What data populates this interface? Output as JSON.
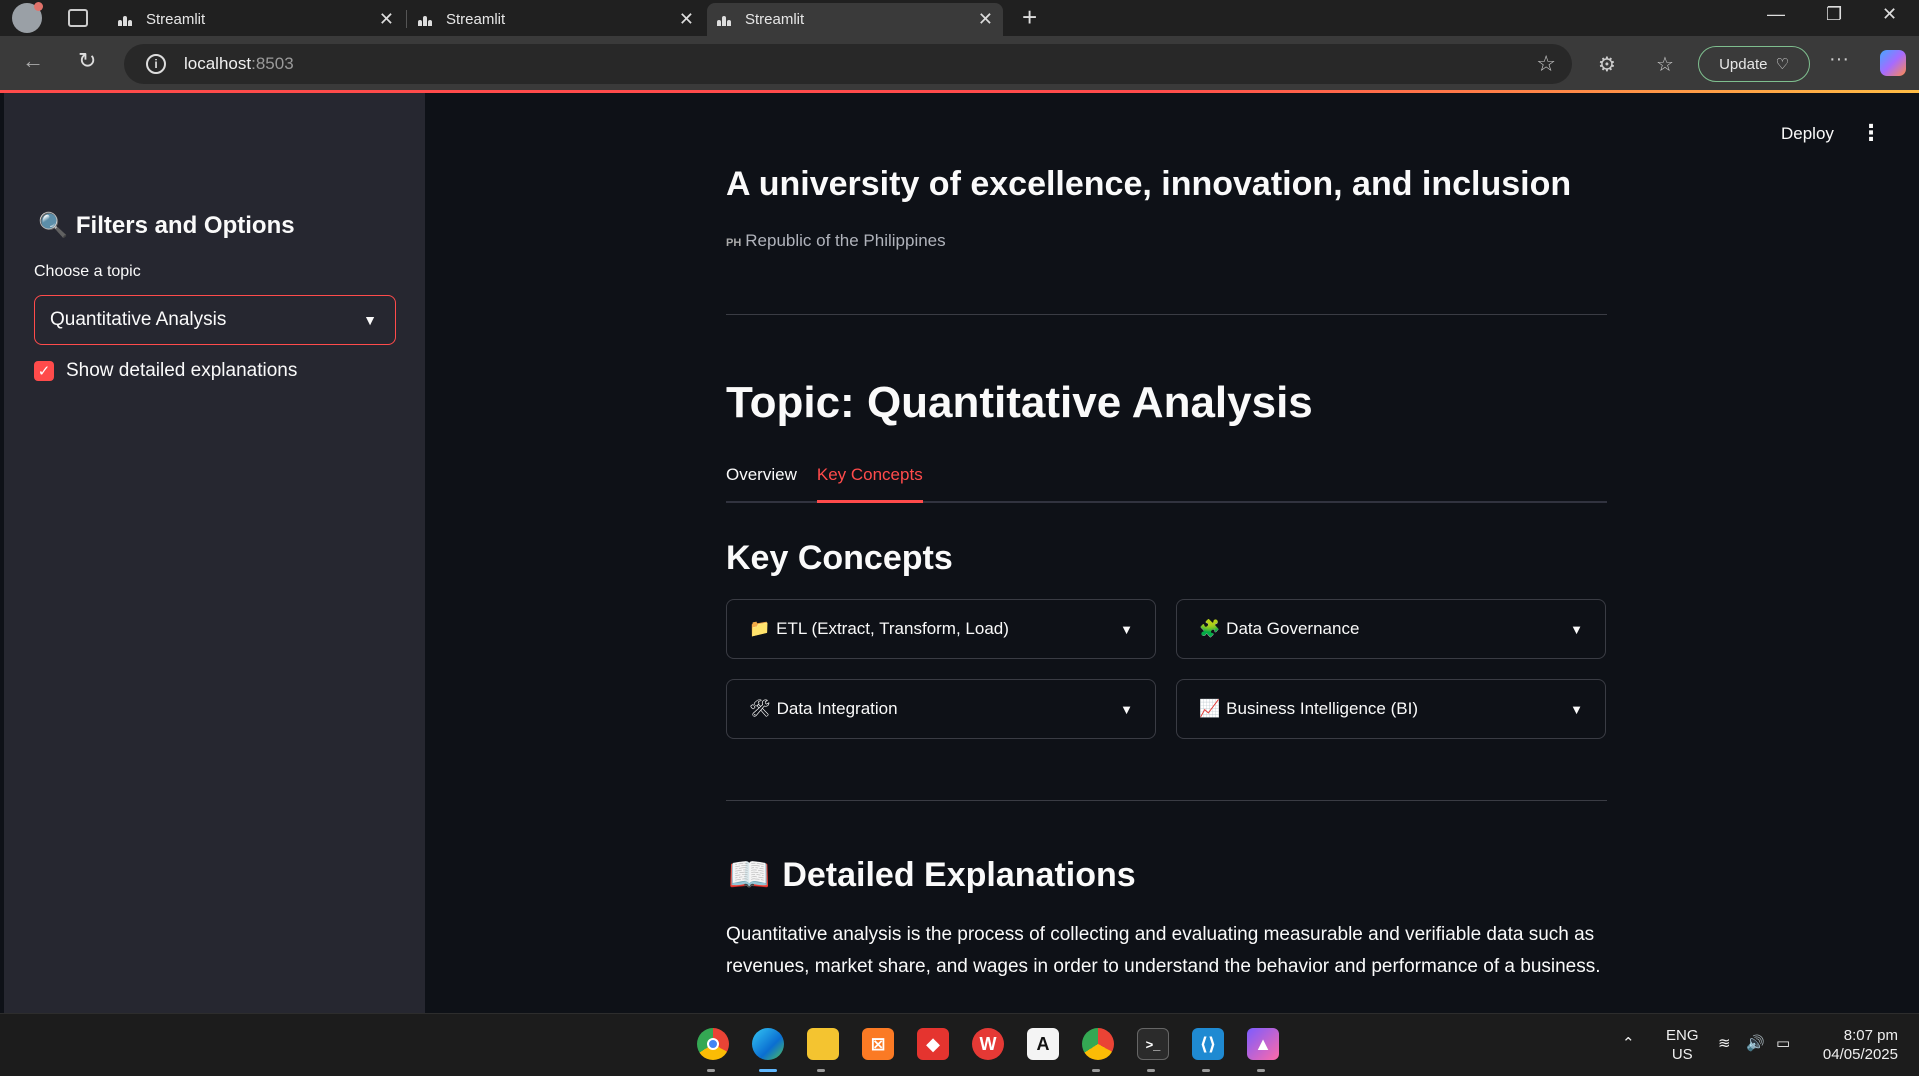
{
  "browser": {
    "tabs": [
      {
        "title": "Streamlit"
      },
      {
        "title": "Streamlit"
      },
      {
        "title": "Streamlit"
      }
    ],
    "url_host": "localhost",
    "url_port": ":8503",
    "update_label": "Update"
  },
  "sidebar": {
    "title": "Filters and Options",
    "select_label": "Choose a topic",
    "select_value": "Quantitative Analysis",
    "checkbox_label": "Show detailed explanations",
    "checkbox_checked": true
  },
  "header": {
    "deploy_label": "Deploy"
  },
  "main": {
    "title": "A university of excellence, innovation, and inclusion",
    "location_flag": "PH",
    "location": "Republic of the Philippines",
    "topic_heading": "Topic: Quantitative Analysis",
    "tabs": [
      {
        "label": "Overview",
        "active": false
      },
      {
        "label": "Key Concepts",
        "active": true
      }
    ],
    "key_concepts_heading": "Key Concepts",
    "concepts": [
      {
        "emoji": "📁",
        "label": "ETL (Extract, Transform, Load)"
      },
      {
        "emoji": "🧩",
        "label": "Data Governance"
      },
      {
        "emoji": "🛠",
        "label": "Data Integration"
      },
      {
        "emoji": "📈",
        "label": "Business Intelligence (BI)"
      }
    ],
    "detailed_heading": "Detailed Explanations",
    "detailed_text": "Quantitative analysis is the process of collecting and evaluating measurable and verifiable data such as revenues, market share, and wages in order to understand the behavior and performance of a business."
  },
  "taskbar": {
    "lang_top": "ENG",
    "lang_bottom": "US",
    "time": "8:07 pm",
    "date": "04/05/2025"
  },
  "colors": {
    "accent": "#ff4b4b",
    "app_bg": "#0e1117",
    "sidebar_bg": "#262730"
  }
}
